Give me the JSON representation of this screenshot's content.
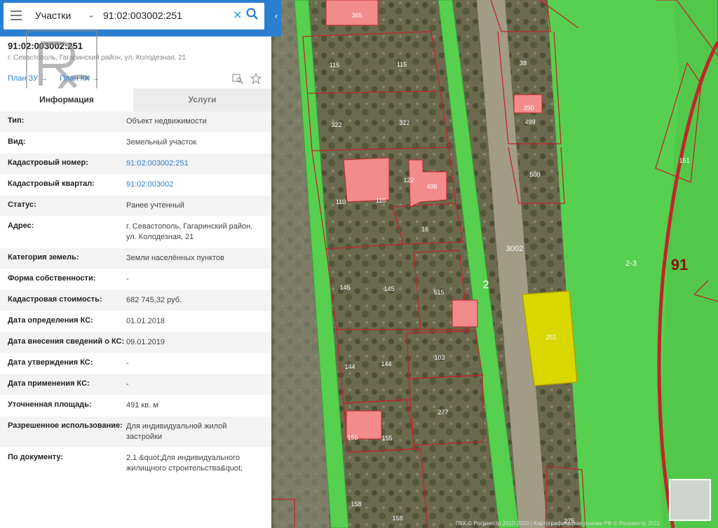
{
  "search": {
    "layer": "Участки",
    "query": "91:02:003002:251"
  },
  "object": {
    "cadastral_number": "91:02:003002:251",
    "address": "г. Севастополь, Гагаринский район, ул. Колодезная, 21",
    "plan_zu": "План ЗУ →",
    "plan_kk": "План КК →"
  },
  "tabs": [
    "Информация",
    "Услуги"
  ],
  "rows": [
    {
      "label": "Тип:",
      "value": "Объект недвижимости"
    },
    {
      "label": "Вид:",
      "value": "Земельный участок"
    },
    {
      "label": "Кадастровый номер:",
      "value": "91:02:003002:251"
    },
    {
      "label": "Кадастровый квартал:",
      "value": "91:02:003002"
    },
    {
      "label": "Статус:",
      "value": "Ранее учтенный"
    },
    {
      "label": "Адрес:",
      "value": "г. Севастополь, Гагаринский район, ул. Колодезная, 21"
    },
    {
      "label": "Категория земель:",
      "value": "Земли населённых пунктов"
    },
    {
      "label": "Форма собственности:",
      "value": "-"
    },
    {
      "label": "Кадастровая стоимость:",
      "value": "682 745,32 руб."
    },
    {
      "label": "Дата определения КС:",
      "value": "01.01.2018"
    },
    {
      "label": "Дата внесения сведений о КС:",
      "value": "09.01.2019"
    },
    {
      "label": "Дата утверждения КС:",
      "value": "-"
    },
    {
      "label": "Дата применения КС:",
      "value": "-"
    },
    {
      "label": "Уточненная площадь:",
      "value": "491 кв. м"
    },
    {
      "label": "Разрешенное использование:",
      "value": "Для индивидуальной жилой застройки"
    },
    {
      "label": "По документу:",
      "value": "2.1 &quot;Для индивидуального жилищного строительства&quot;"
    }
  ],
  "map_labels": {
    "p365": "365",
    "p115a": "115",
    "p115b": "115",
    "p322a": "322",
    "p322b": "322",
    "p38": "38",
    "p390": "390",
    "p499": "499",
    "p500": "500",
    "p151": "151",
    "p122": "122",
    "p496": "496",
    "p110a": "110",
    "p110b": "110",
    "p16": "16",
    "p3002": "3002",
    "p2_3": "2-3",
    "p91": "91",
    "p145a": "145",
    "p145b": "145",
    "p515": "515",
    "p2": "2",
    "p251": "251",
    "p144a": "144",
    "p144b": "144",
    "p103": "103",
    "p277": "277",
    "p155a": "155",
    "p155b": "155",
    "p158a": "158",
    "p158b": "158",
    "p275": "275",
    "p145": "145"
  },
  "copyright": "ПКК © Росреестр 2010-2020 | Картографическая основа РФ © Росреестр 2011",
  "colors": {
    "accent": "#2a7fd0",
    "selected_parcel": "#d8d800",
    "zone_green": "#56d04e",
    "parcel_border": "#c0262b"
  }
}
